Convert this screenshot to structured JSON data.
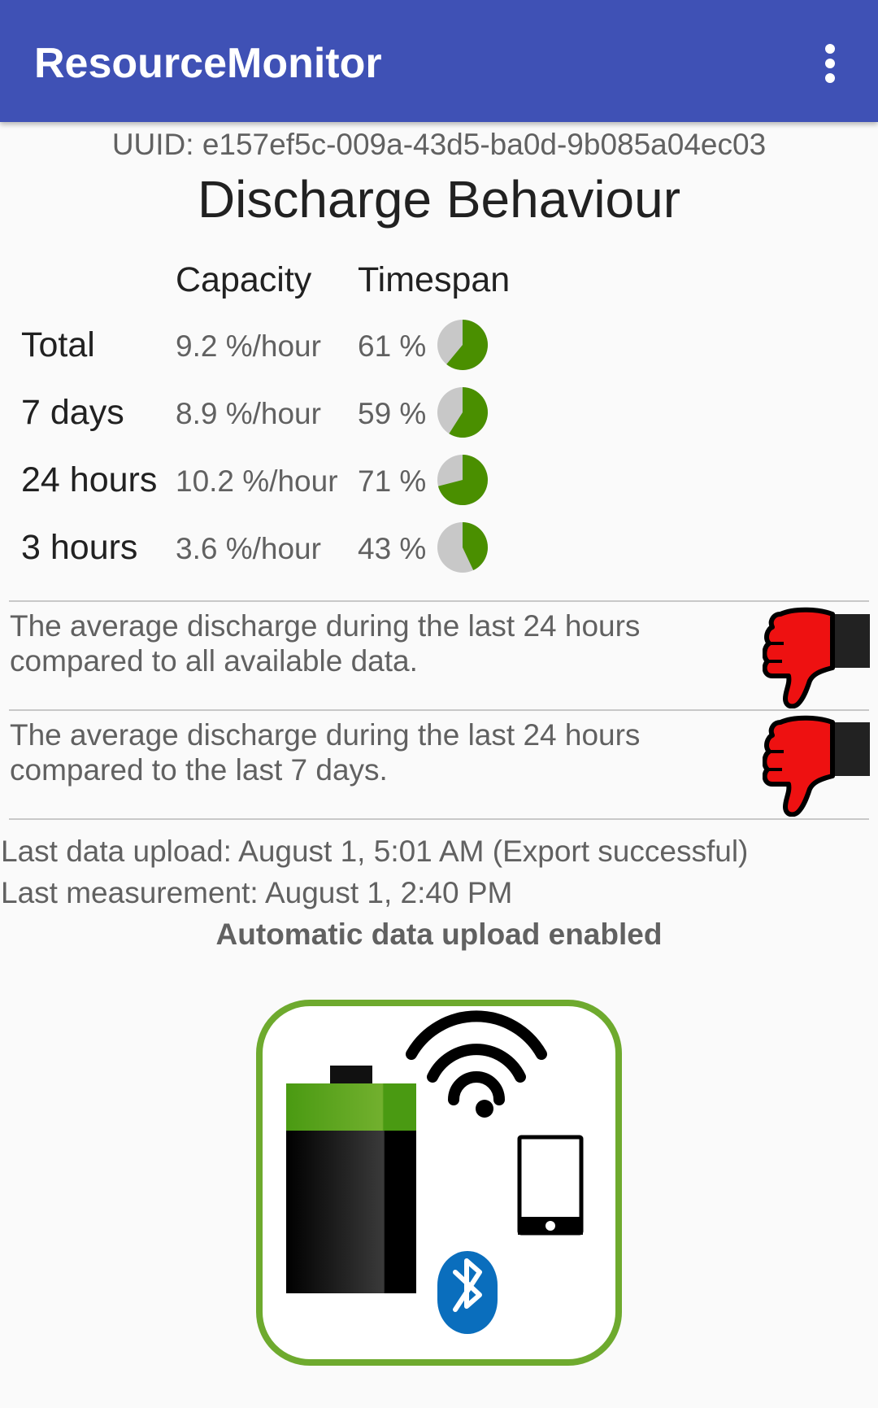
{
  "appbar": {
    "title": "ResourceMonitor"
  },
  "uuid_text": "UUID: e157ef5c-009a-43d5-ba0d-9b085a04ec03",
  "heading": "Discharge Behaviour",
  "table": {
    "columns": [
      "Capacity",
      "Timespan"
    ],
    "rows": [
      {
        "label": "Total",
        "capacity": "9.2 %/hour",
        "timespan": "61 %",
        "timespan_fraction": 0.61
      },
      {
        "label": "7 days",
        "capacity": "8.9 %/hour",
        "timespan": "59 %",
        "timespan_fraction": 0.59
      },
      {
        "label": "24 hours",
        "capacity": "10.2 %/hour",
        "timespan": "71 %",
        "timespan_fraction": 0.71
      },
      {
        "label": "3 hours",
        "capacity": "3.6 %/hour",
        "timespan": "43 %",
        "timespan_fraction": 0.43
      }
    ]
  },
  "comparisons": [
    {
      "line1": "The average discharge during the last 24 hours",
      "line2": "compared to all available data.",
      "rating_icon": "thumbs-down-icon"
    },
    {
      "line1": "The average discharge during the last 24 hours",
      "line2": "compared to the last 7 days.",
      "rating_icon": "thumbs-down-icon"
    }
  ],
  "status": {
    "last_upload": "Last data upload: August 1, 5:01 AM (Export successful)",
    "last_measurement": "Last measurement: August 1, 2:40 PM",
    "auto_upload": "Automatic data upload enabled"
  },
  "colors": {
    "appbar": "#3f51b5",
    "pie_fill": "#4a8f00",
    "pie_bg": "#c8c8c8",
    "thumb_red": "#ee1111",
    "logo_border": "#6eaa2e",
    "bluetooth": "#0a6ebd"
  }
}
